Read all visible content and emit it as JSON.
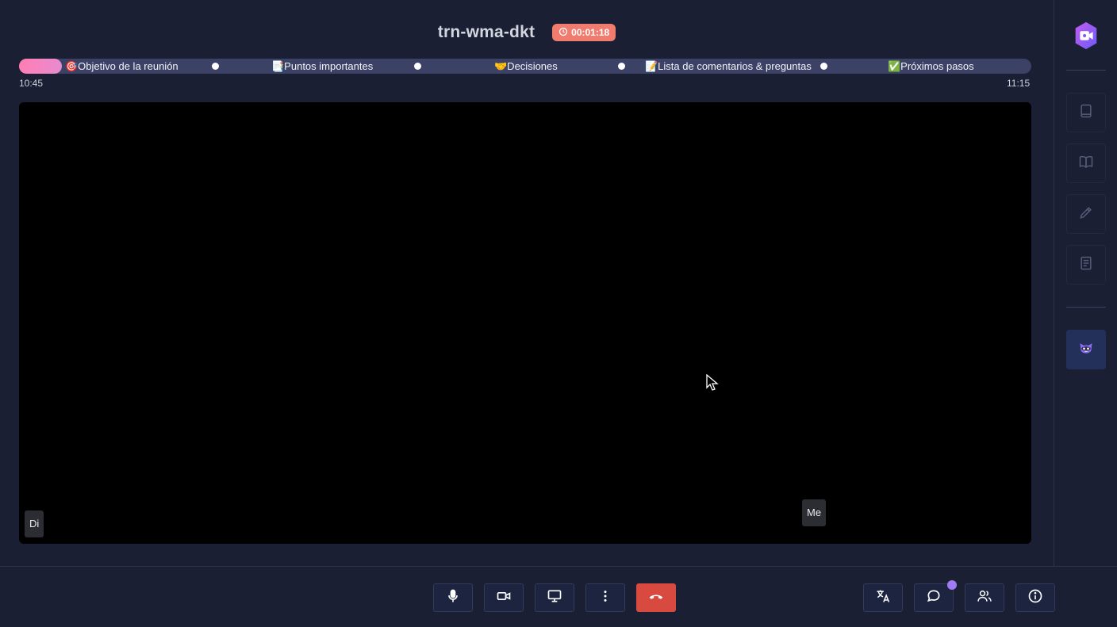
{
  "header": {
    "room_code": "trn-wma-dkt",
    "timer": "00:01:18"
  },
  "agenda": {
    "progress": 0.04,
    "items": [
      {
        "label": "🎯Objetivo de la reunión"
      },
      {
        "label": "📑Puntos importantes"
      },
      {
        "label": "🤝Decisiones"
      },
      {
        "label": "📝Lista de comentarios & preguntas"
      },
      {
        "label": "✅Próximos pasos"
      }
    ],
    "start_time": "10:45",
    "end_time": "11:15"
  },
  "participants": [
    {
      "initials": "Di"
    },
    {
      "initials": "Me"
    }
  ],
  "sidebar": {
    "icons": [
      "app-logo-icon",
      "notebook-icon",
      "book-open-icon",
      "pencil-icon",
      "document-icon",
      "raccoon-assistant-icon"
    ]
  },
  "controls": {
    "icons": [
      "microphone-icon",
      "video-camera-icon",
      "screen-share-icon",
      "more-options-icon",
      "hang-up-icon",
      "translate-icon",
      "chat-icon",
      "participants-icon",
      "info-icon"
    ],
    "chat_has_notification": true
  },
  "colors": {
    "background": "#1a1f33",
    "timer_badge": "#f07b6e",
    "hangup": "#d84a3f",
    "accent": "#a07bf5",
    "progress": "#ff7eb3"
  }
}
